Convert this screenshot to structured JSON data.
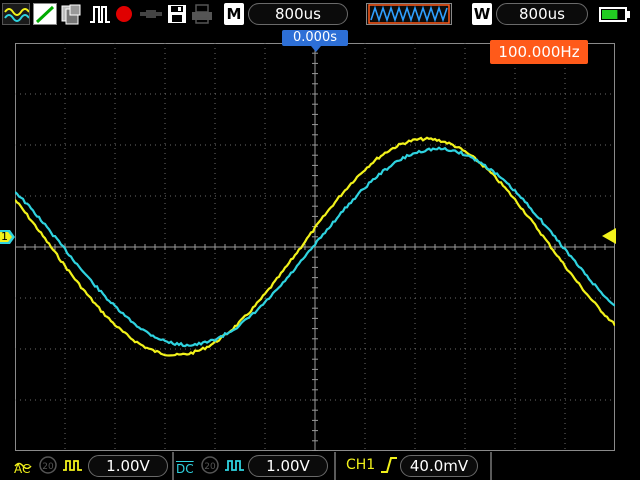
{
  "toolbar": {
    "icons": [
      "wave-mode-icon",
      "slope-icon",
      "stack-icon",
      "pulse-icon",
      "record-icon",
      "probe-icon",
      "save-icon",
      "print-icon"
    ],
    "record_color": "#e00000"
  },
  "timebase": {
    "main_label": "M",
    "main_value": "800us",
    "window_label": "W",
    "window_value": "800us"
  },
  "battery": {
    "level": 0.7,
    "color": "#22cc22"
  },
  "screen": {
    "trigger_position": "0.000s",
    "frequency": "100.000Hz",
    "ch1_marker": "1",
    "ch1_color": "#f2f21b",
    "ch2_color": "#2fd3e0",
    "grid": true,
    "divisions": {
      "x": 12,
      "y": 8
    }
  },
  "channel1": {
    "coupling": "AC",
    "bandwidth_icon": "bandwidth-limit-icon",
    "scale": "1.00V",
    "color": "#f2f21b"
  },
  "channel2": {
    "coupling": "DC",
    "bandwidth_icon": "bandwidth-limit-icon",
    "scale": "1.00V",
    "color": "#2fd3e0"
  },
  "trigger": {
    "source": "CH1",
    "edge_icon": "rising-edge-icon",
    "level": "40.0mV",
    "color": "#f2f21b"
  }
}
